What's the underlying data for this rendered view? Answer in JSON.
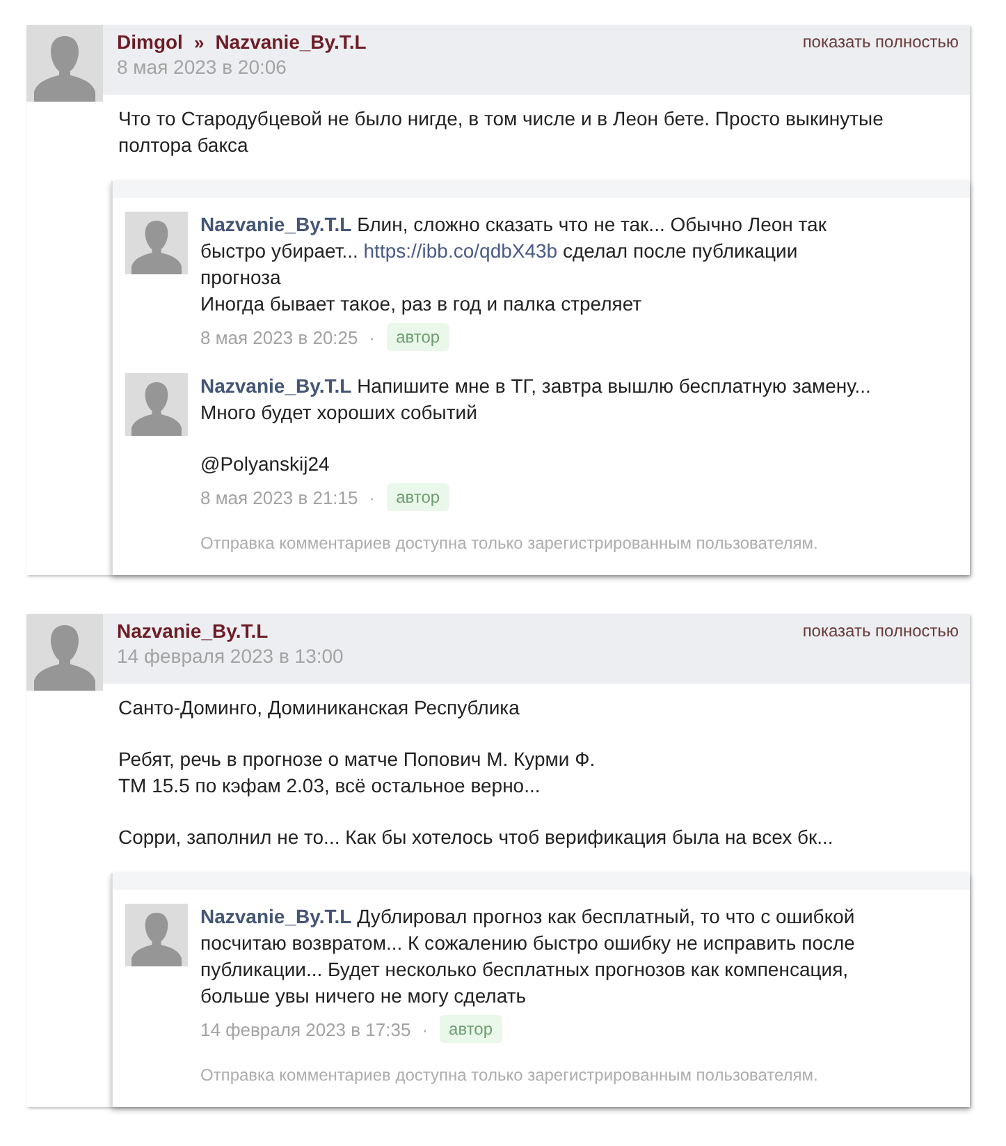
{
  "threads": [
    {
      "author": "Dimgol",
      "separator": "»",
      "recipient": "Nazvanie_By.T.L",
      "date": "8 мая 2023 в 20:06",
      "expand_link": "показать полностью",
      "paragraphs": [
        [
          "Что то Стародубцевой не было нигде, в том числе и в Леон бете. Просто выкинутые полтора бакса"
        ]
      ],
      "replies": [
        {
          "author": "Nazvanie_By.T.L",
          "paragraphs": [
            [
              [
                {
                  "kind": "text",
                  "text": "Блин, сложно сказать что не так... Обычно Леон так быстро убирает... "
                },
                {
                  "kind": "link",
                  "text": "https://ibb.co/qdbX43b"
                },
                {
                  "kind": "text",
                  "text": " сделал после публикации прогноза"
                }
              ],
              [
                {
                  "kind": "text",
                  "text": "Иногда бывает такое, раз в год и палка стреляет"
                }
              ]
            ]
          ],
          "date": "8 мая 2023 в 20:25",
          "dot": "·",
          "badge": "автор"
        },
        {
          "author": "Nazvanie_By.T.L",
          "paragraphs": [
            [
              [
                {
                  "kind": "text",
                  "text": "Напишите мне в ТГ, завтра вышлю бесплатную замену... Много будет хороших событий"
                }
              ]
            ],
            [
              [
                {
                  "kind": "text",
                  "text": "@Polyanskij24"
                }
              ]
            ]
          ],
          "date": "8 мая 2023 в 21:15",
          "dot": "·",
          "badge": "автор"
        }
      ],
      "notice": "Отправка комментариев доступна только зарегистрированным пользователям."
    },
    {
      "author": "Nazvanie_By.T.L",
      "date": "14 февраля 2023 в 13:00",
      "expand_link": "показать полностью",
      "paragraphs": [
        [
          "Санто-Доминго, Доминиканская Республика"
        ],
        [
          "Ребят, речь в прогнозе о матче Попович М. Курми Ф.",
          "ТМ 15.5 по кэфам 2.03, всё остальное верно..."
        ],
        [
          "Сорри, заполнил не то... Как бы хотелось чтоб верификация была на всех бк..."
        ]
      ],
      "replies": [
        {
          "author": "Nazvanie_By.T.L",
          "paragraphs": [
            [
              [
                {
                  "kind": "text",
                  "text": "Дублировал прогноз как бесплатный, то что с ошибкой посчитаю возвратом... К сожалению быстро ошибку не исправить после публикации... Будет несколько бесплатных прогнозов как компенсация, больше увы ничего не могу сделать"
                }
              ]
            ]
          ],
          "date": "14 февраля 2023 в 17:35",
          "dot": "·",
          "badge": "автор"
        }
      ],
      "notice": "Отправка комментариев доступна только зарегистрированным пользователям."
    }
  ]
}
